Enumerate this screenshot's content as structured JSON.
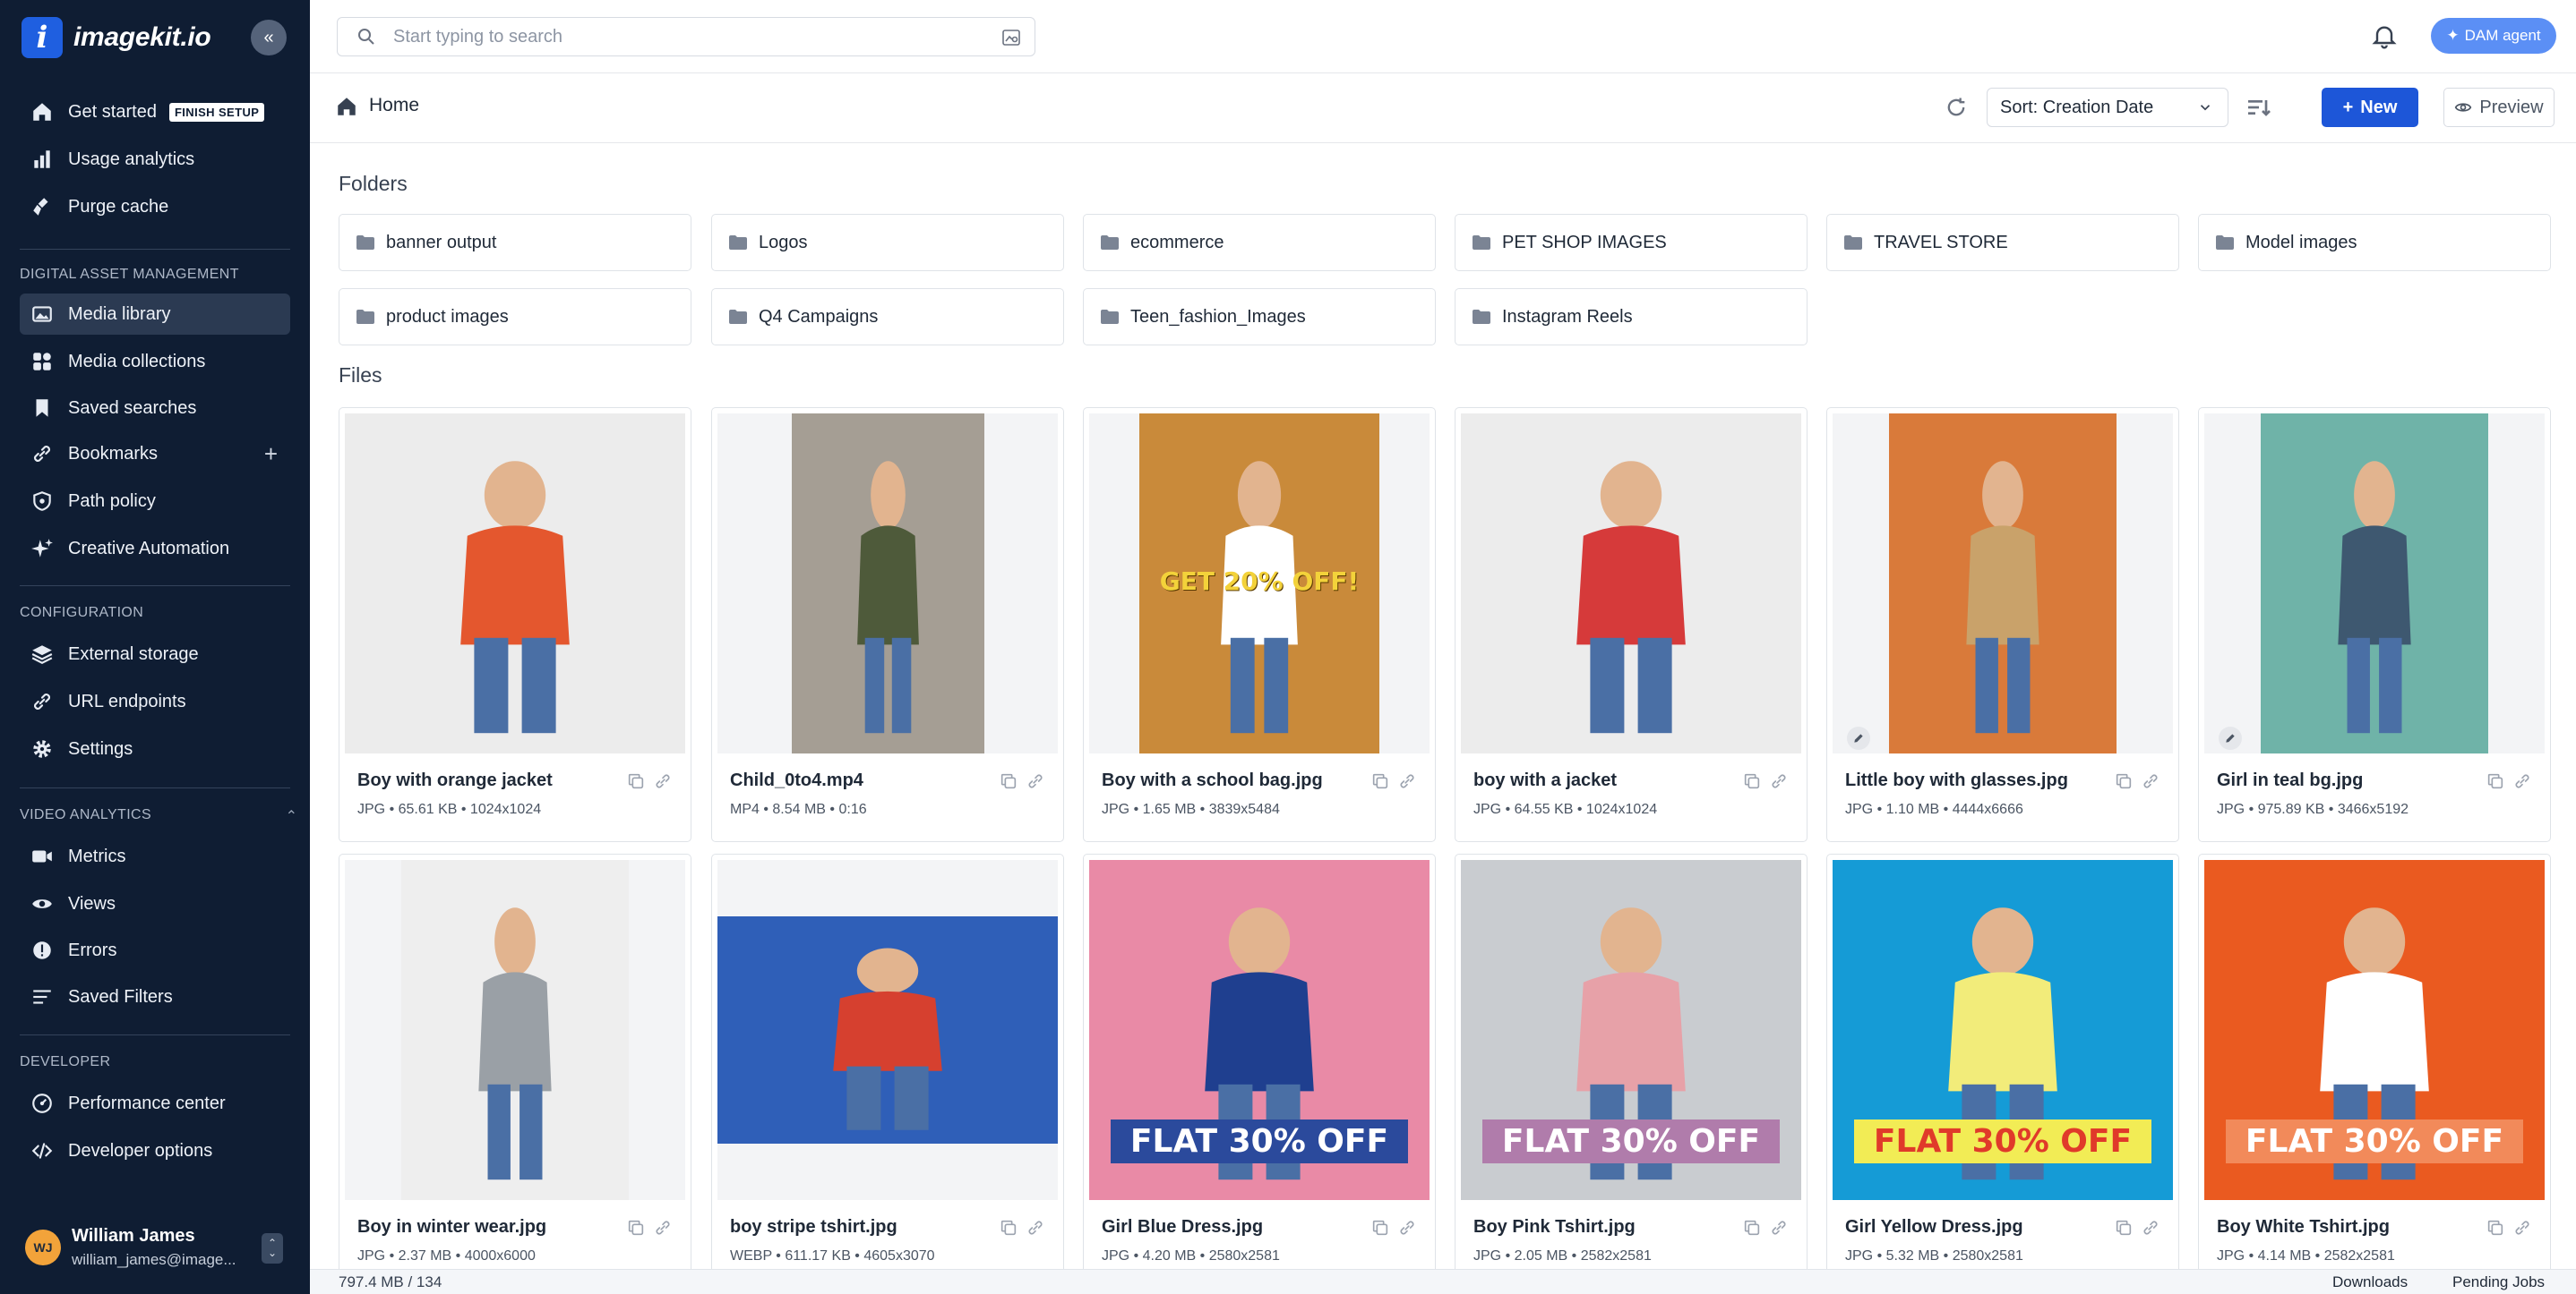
{
  "app": {
    "logo_letter": "i",
    "logo_text": "imagekit.io",
    "collapse_glyph": "«"
  },
  "sidebar": {
    "top_items": [
      {
        "label": "Get started",
        "badge": "FINISH SETUP",
        "icon": "home-icon"
      },
      {
        "label": "Usage analytics",
        "icon": "bar-chart-icon"
      },
      {
        "label": "Purge cache",
        "icon": "broom-icon"
      }
    ],
    "dam": {
      "heading": "DIGITAL ASSET MANAGEMENT",
      "items": [
        {
          "label": "Media library",
          "icon": "image-gallery-icon",
          "active": true
        },
        {
          "label": "Media collections",
          "icon": "collection-grid-icon"
        },
        {
          "label": "Saved searches",
          "icon": "bookmark-icon"
        },
        {
          "label": "Bookmarks",
          "icon": "link-icon",
          "action": "+"
        },
        {
          "label": "Path policy",
          "icon": "shield-icon"
        },
        {
          "label": "Creative Automation",
          "icon": "sparkle-icon"
        }
      ]
    },
    "config": {
      "heading": "CONFIGURATION",
      "items": [
        {
          "label": "External storage",
          "icon": "layers-icon"
        },
        {
          "label": "URL endpoints",
          "icon": "link-icon"
        },
        {
          "label": "Settings",
          "icon": "gear-icon"
        }
      ]
    },
    "video": {
      "heading": "VIDEO ANALYTICS",
      "items": [
        {
          "label": "Metrics",
          "icon": "video-camera-icon"
        },
        {
          "label": "Views",
          "icon": "eye-icon"
        },
        {
          "label": "Errors",
          "icon": "alert-circle-icon"
        },
        {
          "label": "Saved Filters",
          "icon": "filter-lines-icon"
        }
      ]
    },
    "developer": {
      "heading": "DEVELOPER",
      "items": [
        {
          "label": "Performance center",
          "icon": "gauge-icon"
        },
        {
          "label": "Developer options",
          "icon": "code-icon"
        }
      ]
    },
    "user": {
      "initials": "WJ",
      "name": "William James",
      "email": "william_james@image..."
    }
  },
  "topbar": {
    "search_placeholder": "Start typing to search",
    "dam_agent_label": "DAM agent"
  },
  "toolbar": {
    "breadcrumb": "Home",
    "sort_label": "Sort: Creation Date",
    "new_label": "New",
    "preview_label": "Preview"
  },
  "folders_heading": "Folders",
  "folders": [
    "banner output",
    "Logos",
    "ecommerce",
    "PET SHOP IMAGES",
    "TRAVEL STORE",
    "Model images",
    "product images",
    "Q4 Campaigns",
    "Teen_fashion_Images",
    "Instagram Reels"
  ],
  "files_heading": "Files",
  "files": [
    {
      "name": "Boy with orange jacket",
      "meta": "JPG • 65.61 KB • 1024x1024",
      "bg": "#ececec",
      "accent": "#e4572e"
    },
    {
      "name": "Child_0to4.mp4",
      "meta": "MP4 • 8.54 MB • 0:16",
      "bg": "#a59e94",
      "accent": "#4e5a3a"
    },
    {
      "name": "Boy with a school bag.jpg",
      "meta": "JPG • 1.65 MB • 3839x5484",
      "bg": "#c98a3a",
      "accent": "#ffffff",
      "banner": "GET 20% OFF!"
    },
    {
      "name": "boy with a jacket",
      "meta": "JPG • 64.55 KB • 1024x1024",
      "bg": "#ececec",
      "accent": "#d63a3a"
    },
    {
      "name": "Little boy with glasses.jpg",
      "meta": "JPG • 1.10 MB • 4444x6666",
      "bg": "#d97a3a",
      "accent": "#c9a26a"
    },
    {
      "name": "Girl in teal bg.jpg",
      "meta": "JPG • 975.89 KB • 3466x5192",
      "bg": "#6fb3a8",
      "accent": "#3e5870"
    },
    {
      "name": "Boy in winter wear.jpg",
      "meta": "JPG • 2.37 MB • 4000x6000",
      "bg": "#eeeeee",
      "accent": "#9aa0a6"
    },
    {
      "name": "boy stripe tshirt.jpg",
      "meta": "WEBP • 611.17 KB • 4605x3070",
      "bg": "#2f5fb8",
      "accent": "#d6402f"
    },
    {
      "name": "Girl Blue Dress.jpg",
      "meta": "JPG • 4.20 MB • 2580x2581",
      "bg": "#e98aa6",
      "accent": "#1f3f8f",
      "banner": "FLAT 30% OFF"
    },
    {
      "name": "Boy Pink Tshirt.jpg",
      "meta": "JPG • 2.05 MB • 2582x2581",
      "bg": "#c9ccd0",
      "accent": "#e7a1a8",
      "banner": "FLAT 30% OFF"
    },
    {
      "name": "Girl Yellow Dress.jpg",
      "meta": "JPG • 5.32 MB • 2580x2581",
      "bg": "#159bd6",
      "accent": "#f2ec7a",
      "banner": "FLAT 30% OFF"
    },
    {
      "name": "Boy White Tshirt.jpg",
      "meta": "JPG • 4.14 MB • 2582x2581",
      "bg": "#ea5a20",
      "accent": "#ffffff",
      "banner": "FLAT 30% OFF"
    }
  ],
  "footer": {
    "storage": "797.4 MB / 134",
    "downloads": "Downloads",
    "pending": "Pending Jobs"
  },
  "colors": {
    "sidebar_bg": "#0f1d33",
    "primary": "#1d56d8",
    "dam_agent": "#5b8ff5"
  }
}
